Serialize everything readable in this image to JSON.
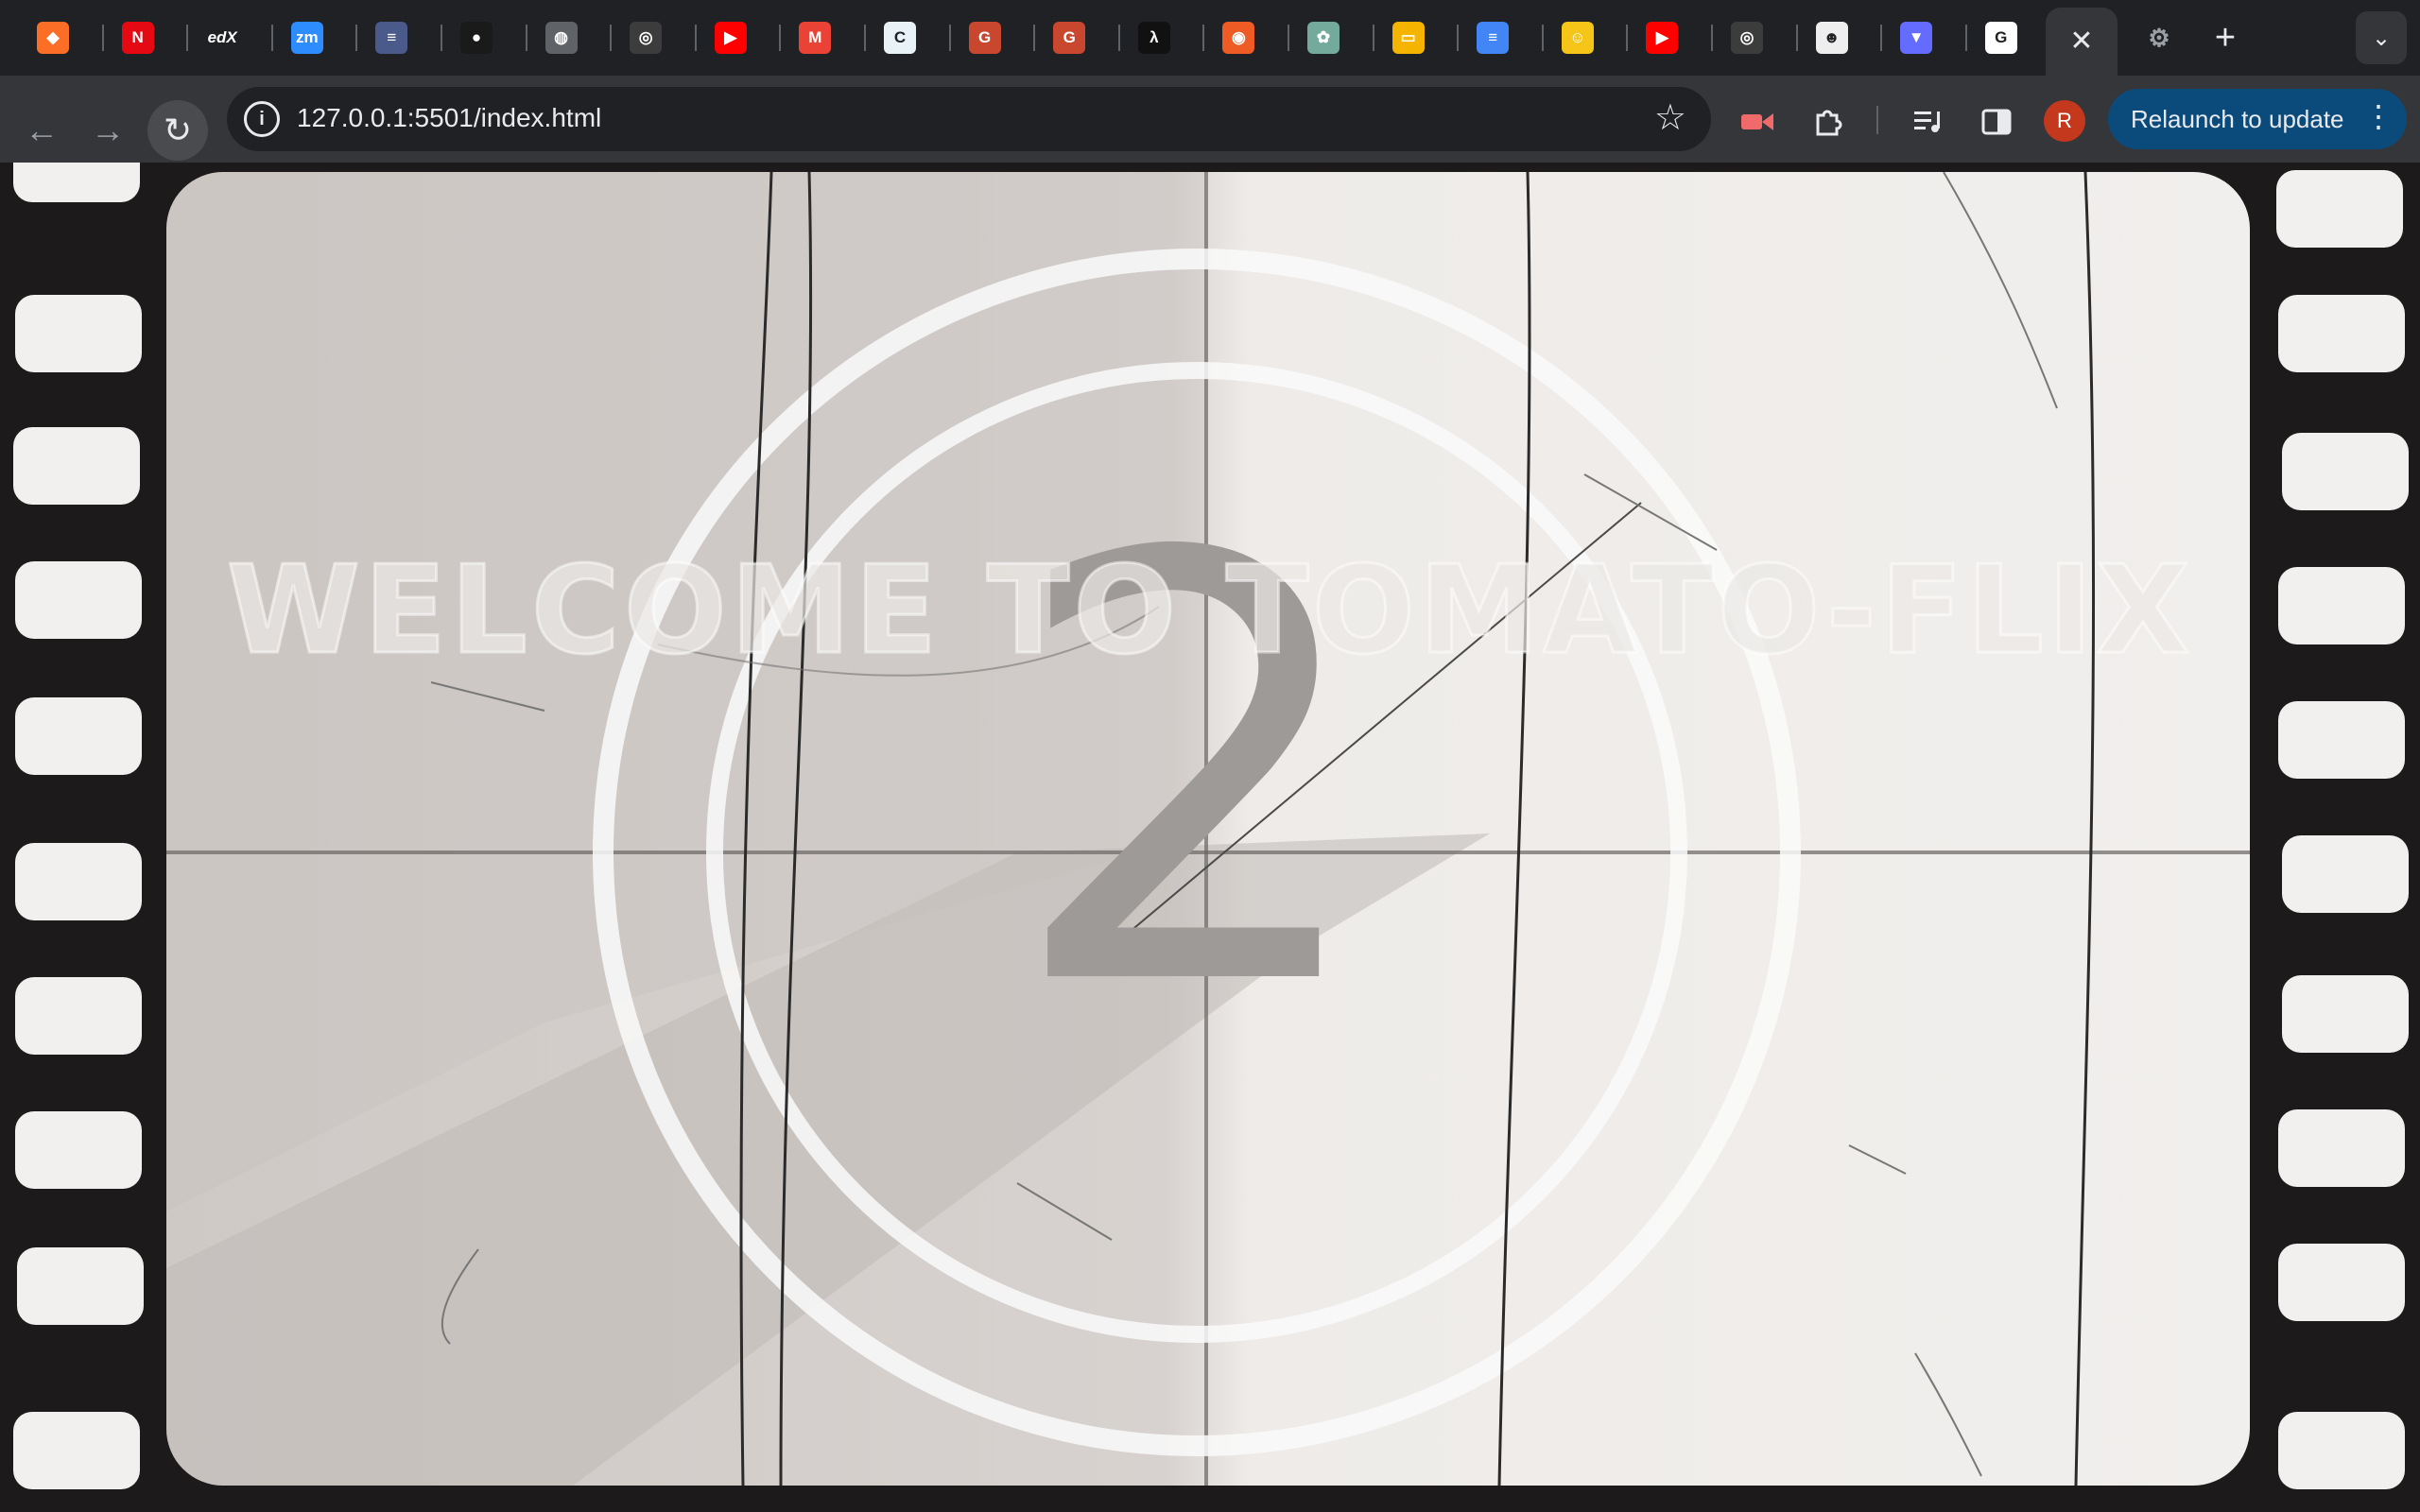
{
  "browser": {
    "tabs": [
      {
        "icon": "gitlab-icon",
        "color": "#fc6d26",
        "glyph": "◆"
      },
      {
        "icon": "netflix-icon",
        "color": "#e50914",
        "glyph": "N"
      },
      {
        "icon": "edx-icon",
        "color": "#202124",
        "glyph": "edX"
      },
      {
        "icon": "zoom-icon",
        "color": "#2d8cff",
        "glyph": "zm"
      },
      {
        "icon": "docs-icon",
        "color": "#4a5a8a",
        "glyph": "≡"
      },
      {
        "icon": "github-dark-icon",
        "color": "#1a1a1a",
        "glyph": "●"
      },
      {
        "icon": "globe-icon",
        "color": "#5f6368",
        "glyph": "◍"
      },
      {
        "icon": "github-icon",
        "color": "#3c3c3c",
        "glyph": "◎"
      },
      {
        "icon": "youtube-icon",
        "color": "#ff0000",
        "glyph": "▶"
      },
      {
        "icon": "gmail-icon",
        "color": "#ea4335",
        "glyph": "M"
      },
      {
        "icon": "copyleaks-icon",
        "color": "#e9f3f7",
        "glyph": "C"
      },
      {
        "icon": "grammarly-icon",
        "color": "#c9472f",
        "glyph": "G"
      },
      {
        "icon": "grammarly-icon",
        "color": "#c9472f",
        "glyph": "G"
      },
      {
        "icon": "lambda-icon",
        "color": "#111111",
        "glyph": "λ"
      },
      {
        "icon": "postman-icon",
        "color": "#ef5b25",
        "glyph": "◉"
      },
      {
        "icon": "chatgpt-icon",
        "color": "#74aa9c",
        "glyph": "✿"
      },
      {
        "icon": "slides-icon",
        "color": "#f4b400",
        "glyph": "▭"
      },
      {
        "icon": "docs-icon",
        "color": "#4285f4",
        "glyph": "≡"
      },
      {
        "icon": "emoji-icon",
        "color": "#f5c518",
        "glyph": "☺"
      },
      {
        "icon": "youtube-icon",
        "color": "#ff0000",
        "glyph": "▶"
      },
      {
        "icon": "github-icon",
        "color": "#3c3c3c",
        "glyph": "◎"
      },
      {
        "icon": "avatar-icon",
        "color": "#eeeeee",
        "glyph": "☻"
      },
      {
        "icon": "vite-icon",
        "color": "#646cff",
        "glyph": "▼"
      },
      {
        "icon": "google-icon",
        "color": "#ffffff",
        "glyph": "G"
      }
    ],
    "active_tab_close": "✕",
    "extra_tab_glyph": "⚙",
    "new_tab": "+",
    "tab_search": "⌄",
    "back": "←",
    "forward": "→",
    "reload": "↻",
    "url": "127.0.0.1:5501/index.html",
    "info": "i",
    "star": "☆",
    "avatar_letter": "R",
    "relaunch_label": "Relaunch to update",
    "menu": "⋮"
  },
  "page": {
    "welcome_text": "WELCOME TO TOMATO-FLIX",
    "countdown_number": "2"
  }
}
